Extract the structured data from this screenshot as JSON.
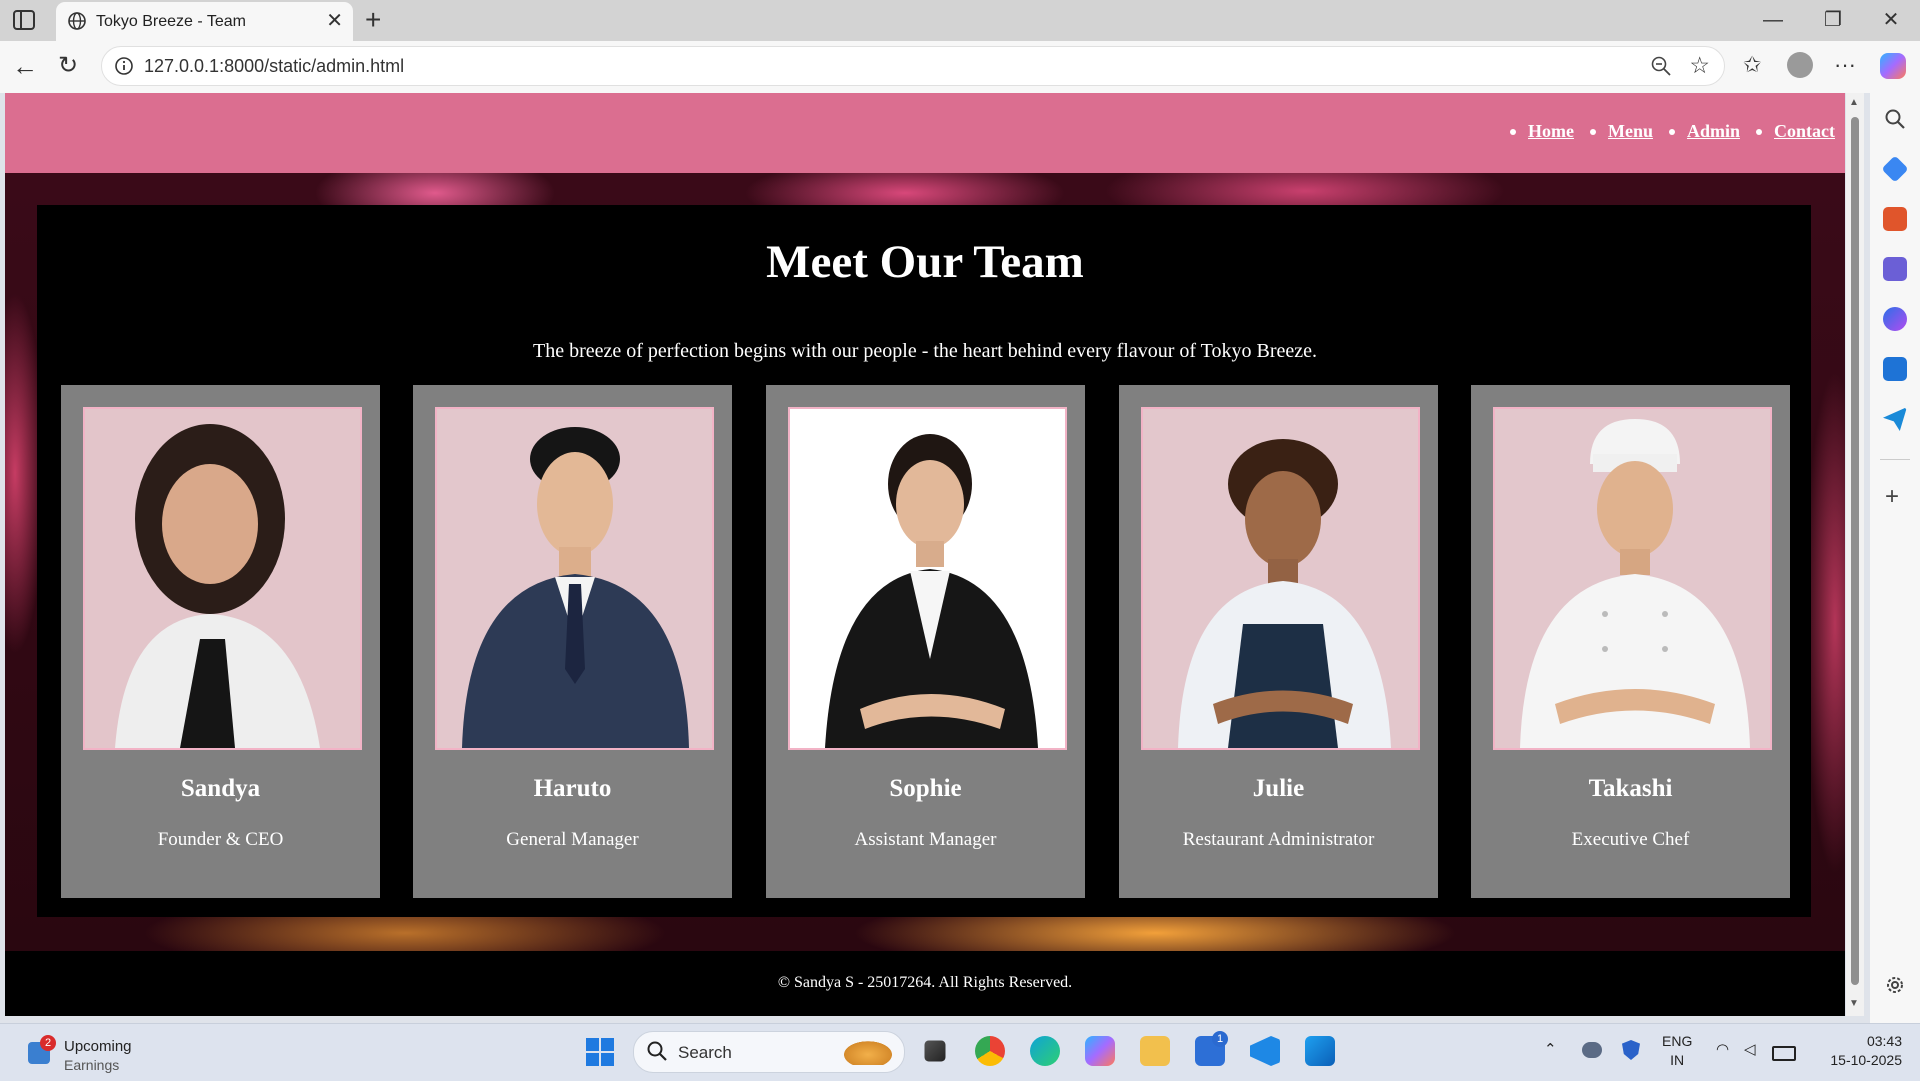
{
  "browser": {
    "tab_title": "Tokyo Breeze - Team",
    "tab_close": "✕",
    "new_tab": "+",
    "url": "127.0.0.1:8000/static/admin.html",
    "window_controls": {
      "minimize": "—",
      "restore": "❐",
      "close": "✕"
    },
    "more": "···",
    "icons": [
      "sidebar-toggle-icon",
      "globe-icon",
      "back-icon",
      "reload-icon",
      "info-icon",
      "zoom-out-icon",
      "favorite-star-icon",
      "favorites-icon",
      "profile-icon",
      "more-icon",
      "copilot-icon"
    ]
  },
  "edge_sidebar": {
    "icons": [
      "search-icon",
      "shopping-tag-icon",
      "toolbox-icon",
      "games-icon",
      "microsoft365-icon",
      "outlook-icon",
      "telegram-icon",
      "add-icon",
      "settings-icon"
    ]
  },
  "site": {
    "nav": [
      {
        "label": "Home"
      },
      {
        "label": "Menu"
      },
      {
        "label": "Admin"
      },
      {
        "label": "Contact"
      }
    ],
    "title": "Meet Our Team",
    "tagline": "The breeze of perfection begins with our people - the heart behind every flavour of Tokyo Breeze.",
    "team": [
      {
        "name": "Sandya",
        "role": "Founder & CEO"
      },
      {
        "name": "Haruto",
        "role": "General Manager"
      },
      {
        "name": "Sophie",
        "role": "Assistant Manager"
      },
      {
        "name": "Julie",
        "role": "Restaurant Administrator"
      },
      {
        "name": "Takashi",
        "role": "Executive Chef"
      }
    ],
    "footer": "© Sandya S - 25017264. All Rights Reserved.",
    "colors": {
      "header": "#db6e90",
      "card": "#808080",
      "photo_border": "#f2b3c6",
      "panel": "#000000"
    }
  },
  "taskbar": {
    "widget_title": "Upcoming",
    "widget_subtitle": "Earnings",
    "widget_badge": "2",
    "search_label": "Search",
    "store_badge": "1",
    "lang_line1": "ENG",
    "lang_line2": "IN",
    "time": "03:43",
    "date": "15-10-2025",
    "tray_icons": [
      "chevron-up-icon",
      "onedrive-icon",
      "security-icon",
      "wifi-icon",
      "volume-icon",
      "battery-icon"
    ],
    "apps": [
      "task-view-icon",
      "chrome-icon",
      "edge-icon",
      "copilot-app-icon",
      "file-explorer-icon",
      "store-icon",
      "vscode-icon",
      "photos-icon"
    ]
  }
}
